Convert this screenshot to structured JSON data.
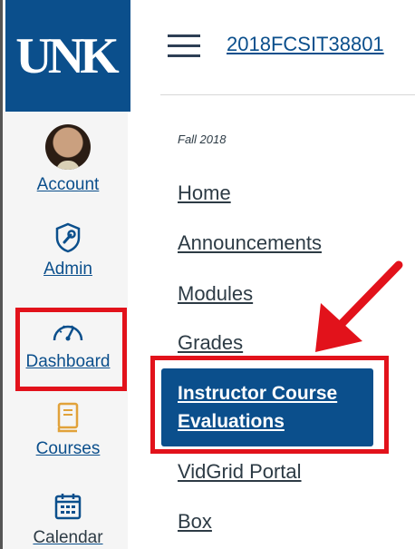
{
  "global_nav": {
    "logo_text": "UNK",
    "items": [
      {
        "label": "Account",
        "icon": "avatar"
      },
      {
        "label": "Admin",
        "icon": "shield-wrench-icon"
      },
      {
        "label": "Dashboard",
        "icon": "speedometer-icon"
      },
      {
        "label": "Courses",
        "icon": "book-icon"
      },
      {
        "label": "Calendar",
        "icon": "calendar-icon"
      }
    ]
  },
  "header": {
    "course_code": "2018FCSIT38801"
  },
  "course_nav": {
    "term": "Fall 2018",
    "items": [
      {
        "label": "Home"
      },
      {
        "label": "Announcements"
      },
      {
        "label": "Modules"
      },
      {
        "label": "Grades"
      },
      {
        "label": "Instructor Course Evaluations",
        "active": true
      },
      {
        "label": "VidGrid Portal"
      },
      {
        "label": "Box"
      }
    ]
  },
  "annotations": {
    "highlight_color": "#e2121b",
    "highlighted": [
      "Dashboard",
      "Instructor Course Evaluations"
    ]
  },
  "colors": {
    "brand": "#0b4f8c",
    "text": "#2d3b45"
  }
}
